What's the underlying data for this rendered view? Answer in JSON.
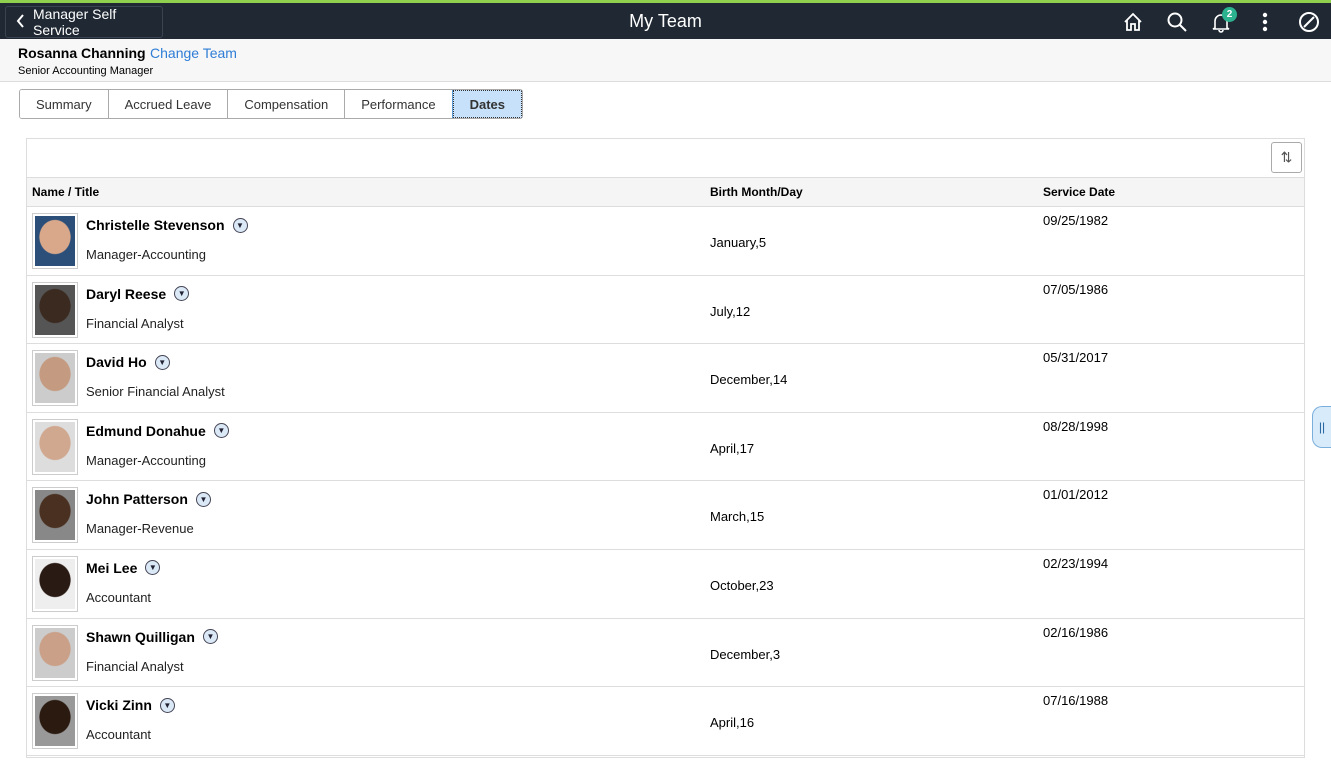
{
  "topbar": {
    "back_label": "Manager Self Service",
    "title": "My Team",
    "notification_count": "2"
  },
  "header": {
    "manager_name": "Rosanna Channing",
    "change_team": "Change Team",
    "manager_title": "Senior Accounting Manager"
  },
  "tabs": [
    {
      "label": "Summary"
    },
    {
      "label": "Accrued Leave"
    },
    {
      "label": "Compensation"
    },
    {
      "label": "Performance"
    },
    {
      "label": "Dates",
      "active": true
    }
  ],
  "grid": {
    "columns": {
      "name": "Name / Title",
      "birth": "Birth Month/Day",
      "service": "Service Date"
    },
    "rows": [
      {
        "name": "Christelle Stevenson",
        "title": "Manager-Accounting",
        "birth": "January,5",
        "service": "09/25/1982"
      },
      {
        "name": "Daryl Reese",
        "title": "Financial Analyst",
        "birth": "July,12",
        "service": "07/05/1986"
      },
      {
        "name": "David Ho",
        "title": "Senior Financial Analyst",
        "birth": "December,14",
        "service": "05/31/2017"
      },
      {
        "name": "Edmund Donahue",
        "title": "Manager-Accounting",
        "birth": "April,17",
        "service": "08/28/1998"
      },
      {
        "name": "John Patterson",
        "title": "Manager-Revenue",
        "birth": "March,15",
        "service": "01/01/2012"
      },
      {
        "name": "Mei Lee",
        "title": "Accountant",
        "birth": "October,23",
        "service": "02/23/1994"
      },
      {
        "name": "Shawn Quilligan",
        "title": "Financial Analyst",
        "birth": "December,3",
        "service": "02/16/1986"
      },
      {
        "name": "Vicki Zinn",
        "title": "Accountant",
        "birth": "April,16",
        "service": "07/16/1988"
      }
    ]
  }
}
